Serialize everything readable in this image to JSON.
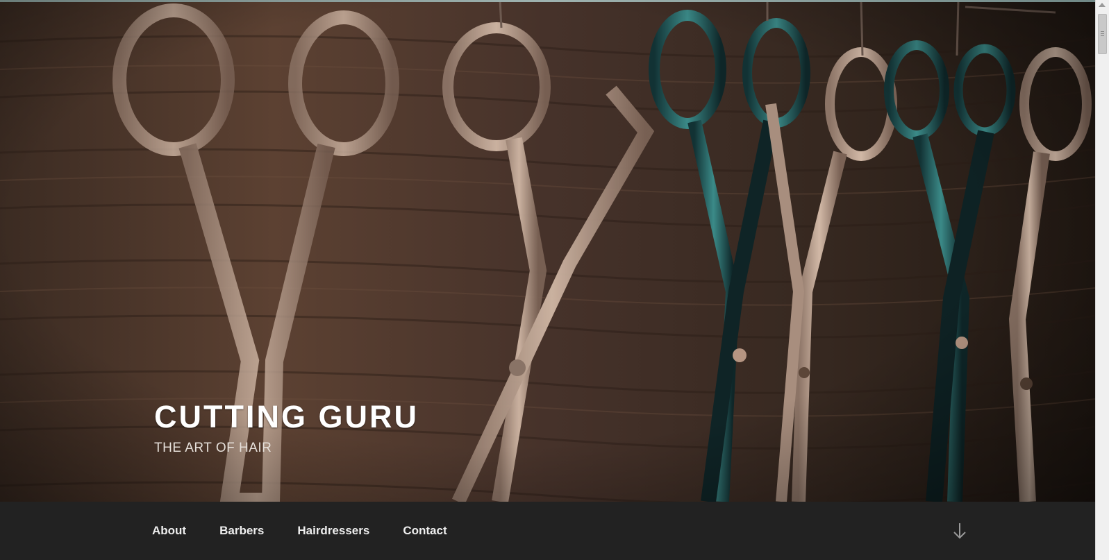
{
  "site": {
    "title": "CUTTING GURU",
    "tagline": "THE ART OF HAIR"
  },
  "header_image": {
    "description_icon": "scissors-photo"
  },
  "nav": {
    "items": [
      {
        "label": "About"
      },
      {
        "label": "Barbers"
      },
      {
        "label": "Hairdressers"
      },
      {
        "label": "Contact"
      }
    ],
    "scroll_icon": "arrow-down-icon"
  },
  "colors": {
    "nav_bg": "#222222",
    "nav_text": "#eeeeee",
    "title": "#ffffff"
  }
}
